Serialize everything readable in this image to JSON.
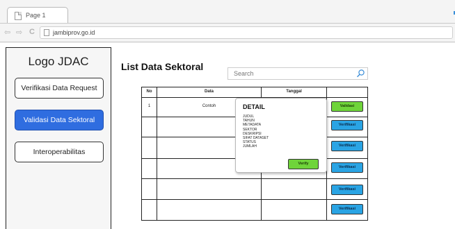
{
  "browser": {
    "tab_title": "Page 1",
    "address": "jambiprov.go.id",
    "icons": [
      "back-arrow-icon",
      "forward-arrow-icon",
      "reload-icon",
      "page-icon"
    ]
  },
  "sidebar": {
    "logo": "Logo JDAC",
    "items": [
      {
        "label": "Verifikasi Data Request",
        "active": false
      },
      {
        "label": "Validasi Data Sektoral",
        "active": true
      },
      {
        "label": "Interoperabilitas",
        "active": false
      }
    ]
  },
  "main": {
    "title": "List Data Sektoral",
    "search": {
      "placeholder": "Search",
      "icon": "search-icon"
    },
    "table": {
      "columns": [
        "No",
        "Data",
        "Tanggal",
        ""
      ],
      "rows": [
        {
          "no": "1",
          "data": "Contoh",
          "tanggal": "",
          "action": "Validasi"
        },
        {
          "no": "",
          "data": "",
          "tanggal": "",
          "action": "Verifikasi"
        },
        {
          "no": "",
          "data": "",
          "tanggal": "",
          "action": "Verifikasi"
        },
        {
          "no": "",
          "data": "",
          "tanggal": "",
          "action": "Verifikasi"
        },
        {
          "no": "",
          "data": "",
          "tanggal": "",
          "action": "Verifikasi"
        },
        {
          "no": "",
          "data": "",
          "tanggal": "",
          "action": "Verifikasi"
        }
      ]
    },
    "detail": {
      "title": "DETAIL",
      "fields": [
        "JUDUL",
        "TAHUN",
        "METADATA",
        "SEKTOR",
        "DESKRIPSI",
        "SIFAT DATASET",
        "STATUS",
        "JUMLAH"
      ],
      "verify_label": "Verify"
    }
  },
  "colors": {
    "active_nav": "#2f6de0",
    "validate_green": "#6fd43a",
    "verify_blue": "#2aa4e4"
  }
}
